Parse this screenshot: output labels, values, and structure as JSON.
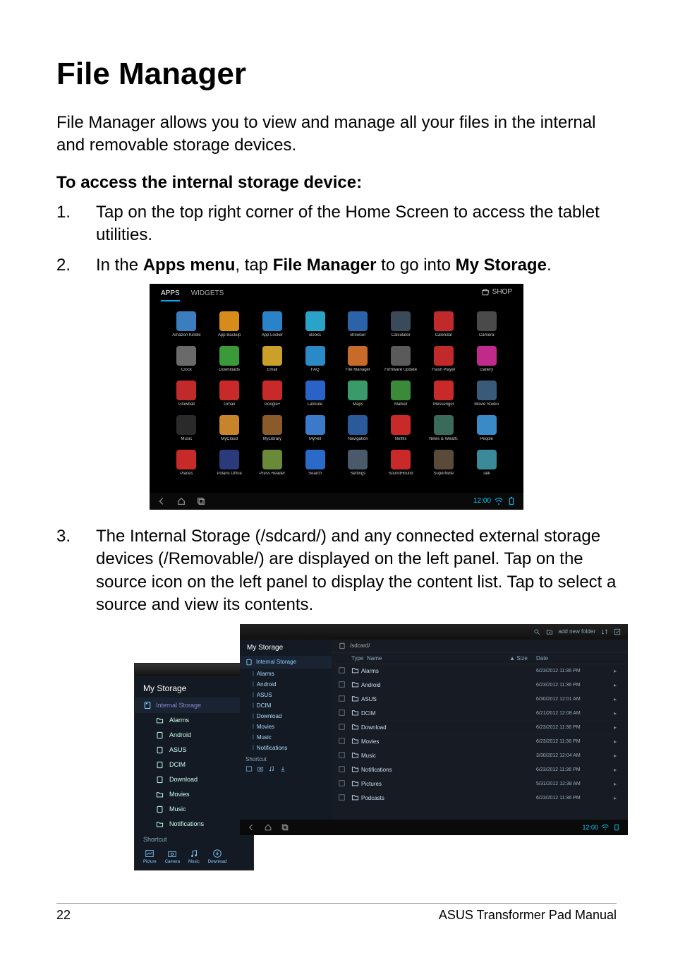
{
  "title": "File Manager",
  "intro": "File Manager allows you to view and manage all your files in the internal and removable storage devices.",
  "sub": "To access the internal storage device:",
  "steps": {
    "s1": {
      "num": "1.",
      "text": "Tap on the top right corner of the Home Screen to access the tablet utilities."
    },
    "s2": {
      "num": "2.",
      "pre": "In the ",
      "b1": "Apps menu",
      "mid": ", tap ",
      "b2": "File Manager",
      "mid2": " to go into ",
      "b3": "My Storage",
      "post": "."
    },
    "s3": {
      "num": "3.",
      "text": "The Internal Storage (/sdcard/) and any connected external storage devices (/Removable/) are displayed on the left panel. Tap on the source icon on the left panel to display the content list. Tap to select a source and view its contents."
    }
  },
  "shot1": {
    "tabs": {
      "apps": "APPS",
      "widgets": "WIDGETS"
    },
    "shop": "SHOP",
    "apps": [
      {
        "l": "Amazon Kindle",
        "c": "#3b7dbf"
      },
      {
        "l": "App Backup",
        "c": "#d68b1a"
      },
      {
        "l": "App Locker",
        "c": "#2a83c8"
      },
      {
        "l": "Books",
        "c": "#2aa3c8"
      },
      {
        "l": "Browser",
        "c": "#2a63a8"
      },
      {
        "l": "Calculator",
        "c": "#3a4a5a"
      },
      {
        "l": "Calendar",
        "c": "#c02a2a"
      },
      {
        "l": "Camera",
        "c": "#4a4a4a"
      },
      {
        "l": "Clock",
        "c": "#6a6a6a"
      },
      {
        "l": "Downloads",
        "c": "#3a9a3a"
      },
      {
        "l": "Email",
        "c": "#caa02a"
      },
      {
        "l": "FAQ",
        "c": "#2a8ac8"
      },
      {
        "l": "File Manager",
        "c": "#c86a2a"
      },
      {
        "l": "Firmware Update",
        "c": "#5a5a5a"
      },
      {
        "l": "Flash Player",
        "c": "#c02a2a"
      },
      {
        "l": "Gallery",
        "c": "#c02a8a"
      },
      {
        "l": "Glowball",
        "c": "#c02a2a"
      },
      {
        "l": "Gmail",
        "c": "#c82a2a"
      },
      {
        "l": "Google+",
        "c": "#c82a2a"
      },
      {
        "l": "Latitude",
        "c": "#2a63c8"
      },
      {
        "l": "Maps",
        "c": "#3a9a6a"
      },
      {
        "l": "Market",
        "c": "#3a8a3a"
      },
      {
        "l": "Messenger",
        "c": "#c82a2a"
      },
      {
        "l": "Movie Studio",
        "c": "#3a5a7a"
      },
      {
        "l": "Music",
        "c": "#2a2a2a"
      },
      {
        "l": "MyCloud",
        "c": "#c8842a"
      },
      {
        "l": "MyLibrary",
        "c": "#8a5a2a"
      },
      {
        "l": "MyNet",
        "c": "#3a7ac8"
      },
      {
        "l": "Navigation",
        "c": "#2a5a9a"
      },
      {
        "l": "Netflix",
        "c": "#c82a2a"
      },
      {
        "l": "News & Weath.",
        "c": "#3a6a5a"
      },
      {
        "l": "People",
        "c": "#3a8ac8"
      },
      {
        "l": "Places",
        "c": "#c82a2a"
      },
      {
        "l": "Polaris Office",
        "c": "#2a3a7a"
      },
      {
        "l": "Press Reader",
        "c": "#6a8a3a"
      },
      {
        "l": "Search",
        "c": "#2a6ac8"
      },
      {
        "l": "Settings",
        "c": "#4a5a6a"
      },
      {
        "l": "SoundHound",
        "c": "#c82a2a"
      },
      {
        "l": "SuperNote",
        "c": "#5a4a3a"
      },
      {
        "l": "Talk",
        "c": "#3a8a9a"
      }
    ],
    "clock": "12:00"
  },
  "shot2a": {
    "title": "My Storage",
    "hdr": "Internal Storage",
    "items": [
      {
        "icon": "folder",
        "label": "Alarms"
      },
      {
        "icon": "sd",
        "label": "Android"
      },
      {
        "icon": "sd",
        "label": "ASUS"
      },
      {
        "icon": "sd",
        "label": "DCIM"
      },
      {
        "icon": "sd",
        "label": "Download"
      },
      {
        "icon": "folder",
        "label": "Movies"
      },
      {
        "icon": "sd",
        "label": "Music"
      },
      {
        "icon": "folder",
        "label": "Notifications"
      }
    ],
    "shortcut": "Shortcut",
    "shortcuts": [
      {
        "label": "Picture"
      },
      {
        "label": "Camera"
      },
      {
        "label": "Music"
      },
      {
        "label": "Download"
      }
    ]
  },
  "shot2b": {
    "tbar": {
      "add_folder": "add new folder",
      "search": "",
      "sort": ""
    },
    "side": {
      "title": "My Storage",
      "hdr": "Internal Storage",
      "items": [
        {
          "label": "Alarms"
        },
        {
          "label": "Android"
        },
        {
          "label": "ASUS"
        },
        {
          "label": "DCIM"
        },
        {
          "label": "Download"
        },
        {
          "label": "Movies"
        },
        {
          "label": "Music"
        },
        {
          "label": "Notifications"
        }
      ],
      "shortcut": "Shortcut"
    },
    "crumb": "/sdcard/",
    "cols": {
      "type": "Type",
      "name": "Name",
      "size": "Size",
      "date": "Date",
      "arrow": "▲"
    },
    "rows": [
      {
        "name": "Alarms",
        "date": "6/23/2012 11:36 PM"
      },
      {
        "name": "Android",
        "date": "6/23/2012 11:36 PM"
      },
      {
        "name": "ASUS",
        "date": "6/30/2012 12:01 AM"
      },
      {
        "name": "DCIM",
        "date": "6/21/2012 12:08 AM"
      },
      {
        "name": "Download",
        "date": "6/23/2012 11:36 PM"
      },
      {
        "name": "Movies",
        "date": "6/23/2012 11:36 PM"
      },
      {
        "name": "Music",
        "date": "3/30/2012 12:04 AM"
      },
      {
        "name": "Notifications",
        "date": "6/23/2012 11:36 PM"
      },
      {
        "name": "Pictures",
        "date": "5/31/2012 12:38 AM"
      },
      {
        "name": "Podcasts",
        "date": "6/23/2012 11:36 PM"
      }
    ],
    "clock": "12:00"
  },
  "footer": {
    "page": "22",
    "book": "ASUS Transformer Pad Manual"
  }
}
